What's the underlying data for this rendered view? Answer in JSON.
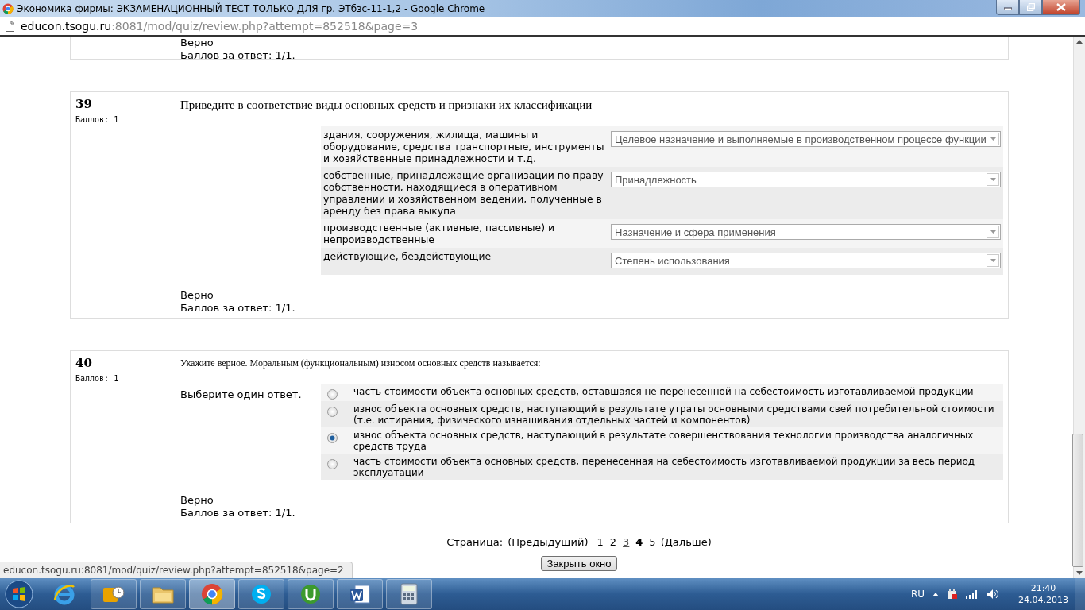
{
  "window": {
    "title": "Экономика фирмы: ЭКЗАМЕНАЦИОННЫЙ ТЕСТ ТОЛЬКО ДЛЯ гр. ЭТбзс-11-1,2 - Google Chrome"
  },
  "address_bar": {
    "host": "educon.tsogu.ru",
    "path": ":8081/mod/quiz/review.php?attempt=852518&page=3"
  },
  "previous_question_tail": {
    "result": "Верно",
    "score": "Баллов за ответ: 1/1."
  },
  "questions": [
    {
      "kind": "match",
      "number": "39",
      "points": "Баллов: 1",
      "text": "Приведите в соответствие виды основных средств и признаки их классификации",
      "pairs": [
        {
          "stem": "здания, сооружения, жилища, машины и оборудование, средства транспортные, инструменты и хозяйственные принадлежности и т.д.",
          "answer": "Целевое назначение и выполняемые в производственном процессе функции"
        },
        {
          "stem": "собственные, принадлежащие организации по праву собственности, находящиеся в оперативном управлении и хозяйственном ведении, полученные в аренду без права выкупа",
          "answer": "Принадлежность"
        },
        {
          "stem": "производственные (активные, пассивные) и непроизводственные",
          "answer": "Назначение и сфера применения"
        },
        {
          "stem": "действующие, бездействующие",
          "answer": "Степень использования"
        }
      ],
      "result": "Верно",
      "score": "Баллов за ответ: 1/1."
    },
    {
      "kind": "choice",
      "number": "40",
      "points": "Баллов: 1",
      "text": "Укажите верное. Моральным (функциональным) износом основных средств называется:",
      "prompt": "Выберите один ответ.",
      "options": [
        {
          "text": "часть стоимости объекта основных средств, оставшаяся не перенесенной на себестоимость изготавливаемой продукции",
          "selected": false
        },
        {
          "text": "износ объекта основных средств, наступающий в результате утраты основными средствами свей потребительной стоимости (т.е. истирания, физического изнашивания отдельных частей и компонентов)",
          "selected": false
        },
        {
          "text": "износ объекта основных средств, наступающий в результате совершенствования технологии производства аналогичных средств труда",
          "selected": true
        },
        {
          "text": "часть стоимости объекта основных средств, перенесенная на себестоимость изготавливаемой продукции за весь период эксплуатации",
          "selected": false
        }
      ],
      "result": "Верно",
      "score": "Баллов за ответ: 1/1."
    }
  ],
  "pagination": {
    "label": "Страница:",
    "previous": "(Предыдущий)",
    "next": "(Дальше)",
    "pages": [
      {
        "label": "1",
        "selected": false,
        "hovered": false
      },
      {
        "label": "2",
        "selected": false,
        "hovered": false
      },
      {
        "label": "3",
        "selected": false,
        "hovered": true
      },
      {
        "label": "4",
        "selected": true,
        "hovered": false
      },
      {
        "label": "5",
        "selected": false,
        "hovered": false
      }
    ]
  },
  "close_button": "Закрыть окно",
  "status_url": "educon.tsogu.ru:8081/mod/quiz/review.php?attempt=852518&page=2",
  "tray": {
    "language": "RU",
    "time": "21:40",
    "date": "24.04.2013"
  }
}
